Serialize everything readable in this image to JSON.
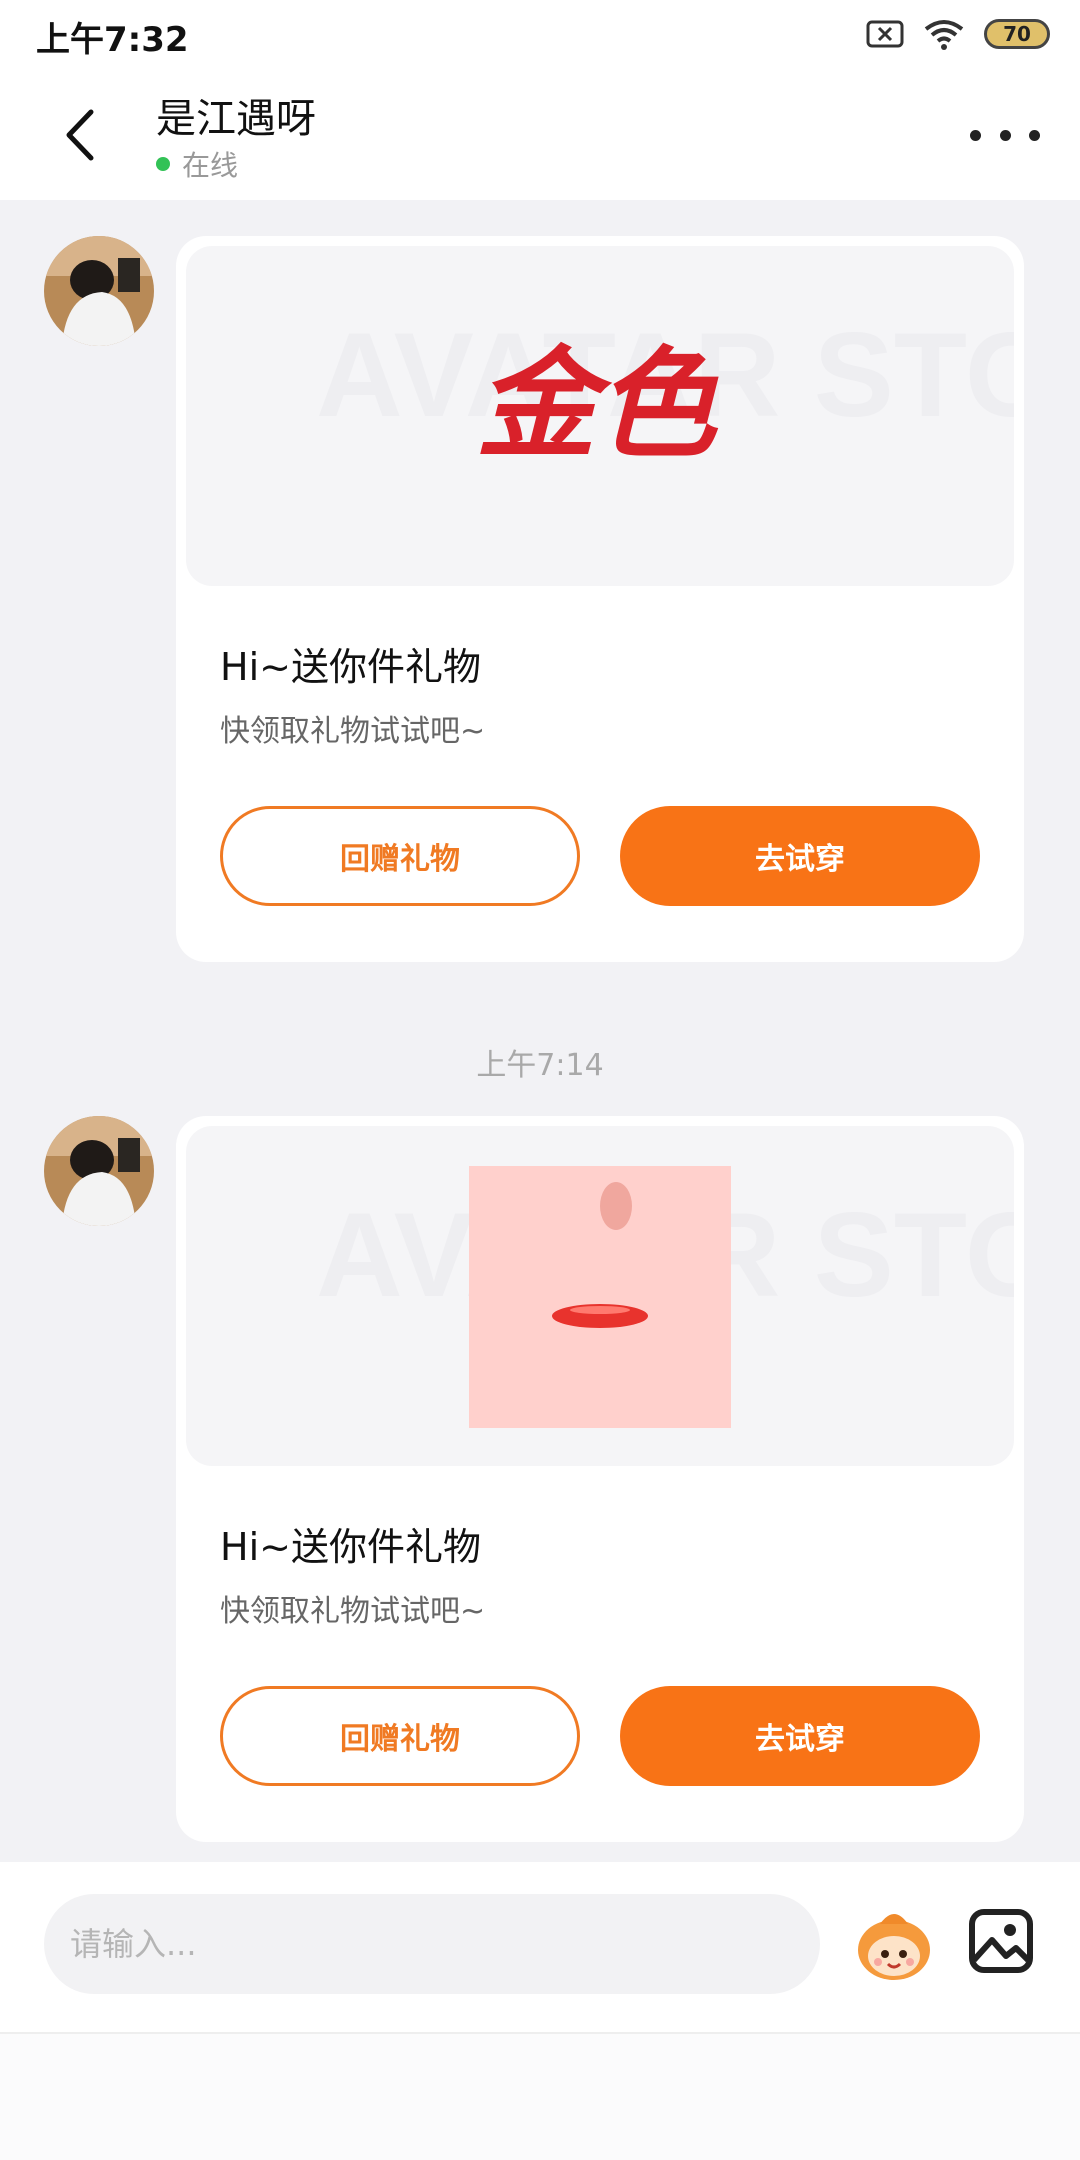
{
  "status_bar": {
    "time": "上午7:32",
    "battery": "70"
  },
  "header": {
    "name": "是江遇呀",
    "status": "在线"
  },
  "messages": [
    {
      "banner_text": "AVATAR STORE",
      "banner_product": "金色",
      "title": "Hi~送你件礼物",
      "subtitle": "快领取礼物试试吧~",
      "btn_gift": "回赠礼物",
      "btn_try": "去试穿"
    },
    {
      "banner_text": "AVATAR STORE",
      "title": "Hi~送你件礼物",
      "subtitle": "快领取礼物试试吧~",
      "btn_gift": "回赠礼物",
      "btn_try": "去试穿"
    }
  ],
  "timestamp": "上午7:14",
  "input": {
    "placeholder": "请输入..."
  },
  "colors": {
    "accent": "#f87316",
    "online": "#32c256"
  }
}
